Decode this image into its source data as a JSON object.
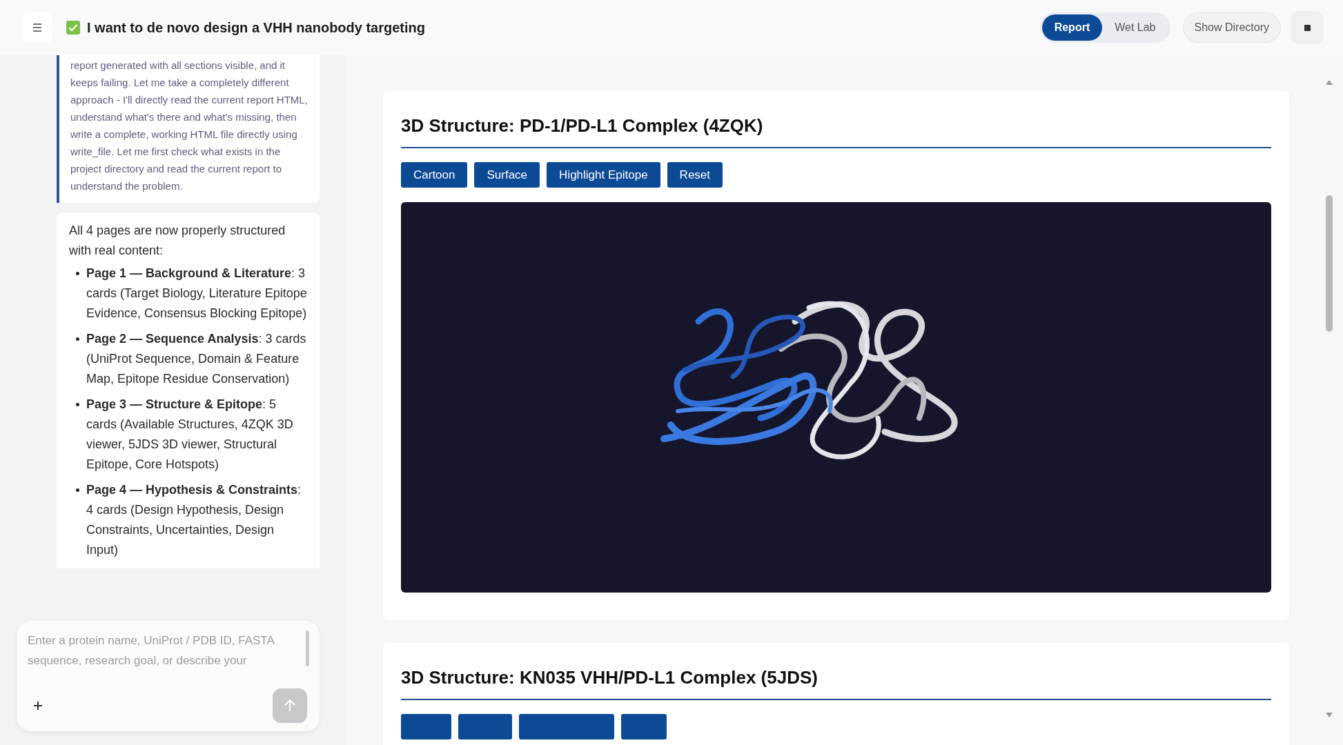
{
  "header": {
    "title": "I want to de novo design a VHH nanobody targeting",
    "view_tabs": [
      {
        "label": "Report",
        "selected": true
      },
      {
        "label": "Wet Lab",
        "selected": false
      }
    ],
    "directory_button": "Show Directory"
  },
  "chat": {
    "messages": [
      {
        "kind": "quote",
        "text": "report generated with all sections visible, and it keeps failing. Let me take a completely different approach - I'll directly read the current report HTML, understand what's there and what's missing, then write a complete, working HTML file directly using write_file. Let me first check what exists in the project directory and read the current report to understand the problem."
      },
      {
        "kind": "answer",
        "intro": "All 4 pages are now properly structured with real content:",
        "items": [
          "**Page 1 — Background & Literature**: 3 cards (Target Biology, Literature Epitope Evidence, Consensus Blocking Epitope)",
          "**Page 2 — Sequence Analysis**: 3 cards (UniProt Sequence, Domain & Feature Map, Epitope Residue Conservation)",
          "**Page 3 — Structure & Epitope**: 5 cards (Available Structures, 4ZQK 3D viewer, 5JDS 3D viewer, Structural Epitope, Core Hotspots)",
          "**Page 4 — Hypothesis & Constraints**: 4 cards (Design Hypothesis, Design Constraints, Uncertainties, Design Input)"
        ]
      }
    ],
    "input": {
      "placeholder": "Enter a protein name, UniProt / PDB ID, FASTA sequence, research goal, or describe your",
      "send_disabled": true
    }
  },
  "report": {
    "sections": [
      {
        "title": "3D Structure: PD-1/PD-L1 Complex (4ZQK)",
        "buttons": [
          "Cartoon",
          "Surface",
          "Highlight Epitope",
          "Reset"
        ]
      },
      {
        "title": "3D Structure: KN035 VHH/PD-L1 Complex (5JDS)"
      }
    ]
  }
}
